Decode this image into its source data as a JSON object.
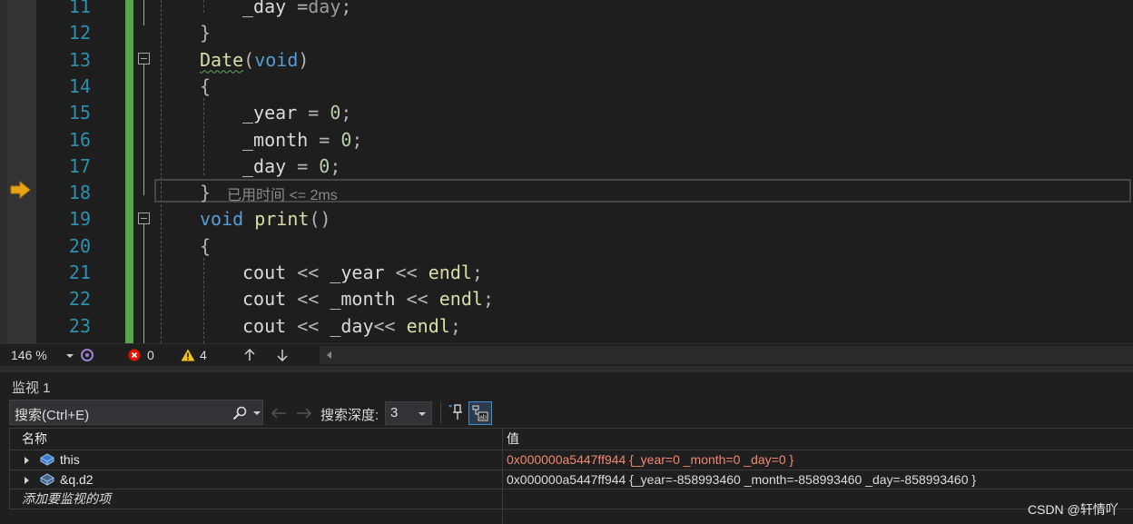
{
  "editor": {
    "lines": [
      {
        "num": "11",
        "tokens": [
          {
            "t": "_day",
            "c": "id"
          },
          {
            "t": " =",
            "c": "op"
          },
          {
            "t": "day",
            "c": "dim"
          },
          {
            "t": ";",
            "c": "op"
          }
        ],
        "indent": 2
      },
      {
        "num": "12",
        "tokens": [
          {
            "t": "}",
            "c": "op"
          }
        ],
        "indent": 1
      },
      {
        "num": "13",
        "tokens": [
          {
            "t": "Date",
            "c": "fn squig"
          },
          {
            "t": "(",
            "c": "op"
          },
          {
            "t": "void",
            "c": "kw"
          },
          {
            "t": ")",
            "c": "op"
          }
        ],
        "indent": 1
      },
      {
        "num": "14",
        "tokens": [
          {
            "t": "{",
            "c": "op"
          }
        ],
        "indent": 1
      },
      {
        "num": "15",
        "tokens": [
          {
            "t": "_year",
            "c": "id"
          },
          {
            "t": " = ",
            "c": "op"
          },
          {
            "t": "0",
            "c": "num"
          },
          {
            "t": ";",
            "c": "op"
          }
        ],
        "indent": 2
      },
      {
        "num": "16",
        "tokens": [
          {
            "t": "_month",
            "c": "id"
          },
          {
            "t": " = ",
            "c": "op"
          },
          {
            "t": "0",
            "c": "num"
          },
          {
            "t": ";",
            "c": "op"
          }
        ],
        "indent": 2
      },
      {
        "num": "17",
        "tokens": [
          {
            "t": "_day",
            "c": "id"
          },
          {
            "t": " = ",
            "c": "op"
          },
          {
            "t": "0",
            "c": "num"
          },
          {
            "t": ";",
            "c": "op"
          }
        ],
        "indent": 2
      },
      {
        "num": "18",
        "tokens": [
          {
            "t": "}",
            "c": "op"
          }
        ],
        "indent": 1
      },
      {
        "num": "19",
        "tokens": [
          {
            "t": "void",
            "c": "kw"
          },
          {
            "t": " ",
            "c": "op"
          },
          {
            "t": "print",
            "c": "fn"
          },
          {
            "t": "()",
            "c": "op"
          }
        ],
        "indent": 1
      },
      {
        "num": "20",
        "tokens": [
          {
            "t": "{",
            "c": "op"
          }
        ],
        "indent": 1
      },
      {
        "num": "21",
        "tokens": [
          {
            "t": "cout",
            "c": "id"
          },
          {
            "t": " << ",
            "c": "op"
          },
          {
            "t": "_year",
            "c": "id"
          },
          {
            "t": " << ",
            "c": "op"
          },
          {
            "t": "endl",
            "c": "fn"
          },
          {
            "t": ";",
            "c": "op"
          }
        ],
        "indent": 2
      },
      {
        "num": "22",
        "tokens": [
          {
            "t": "cout",
            "c": "id"
          },
          {
            "t": " << ",
            "c": "op"
          },
          {
            "t": "_month",
            "c": "id"
          },
          {
            "t": " << ",
            "c": "op"
          },
          {
            "t": "endl",
            "c": "fn"
          },
          {
            "t": ";",
            "c": "op"
          }
        ],
        "indent": 2
      },
      {
        "num": "23",
        "tokens": [
          {
            "t": "cout",
            "c": "id"
          },
          {
            "t": " << ",
            "c": "op"
          },
          {
            "t": "_day",
            "c": "id"
          },
          {
            "t": "<< ",
            "c": "op"
          },
          {
            "t": "endl",
            "c": "fn"
          },
          {
            "t": ";",
            "c": "op"
          }
        ],
        "indent": 2
      }
    ],
    "perf_tip": "已用时间 <= 2ms",
    "current_line": "18"
  },
  "status": {
    "zoom": "146 %",
    "errors": "0",
    "warnings": "4"
  },
  "watch": {
    "title": "监视 1",
    "search_placeholder": "搜索(Ctrl+E)",
    "depth_label": "搜索深度:",
    "depth_value": "3",
    "col_name": "名称",
    "col_value": "值",
    "rows": [
      {
        "name": "this",
        "value": "0x000000a5447ff944 {_year=0 _month=0 _day=0 }",
        "changed": true
      },
      {
        "name": "&q.d2",
        "value": "0x000000a5447ff944 {_year=-858993460 _month=-858993460 _day=-858993460 }",
        "changed": false
      }
    ],
    "add_item": "添加要监视的项"
  },
  "watermark": "CSDN @轩情吖",
  "colors": {
    "keyword": "#569cd6",
    "function": "#dcdcaa",
    "number": "#b5cea8",
    "linenum": "#2b91af",
    "changebar": "#57a64a",
    "changed_value": "#f48771",
    "arrow": "#e8a317"
  }
}
